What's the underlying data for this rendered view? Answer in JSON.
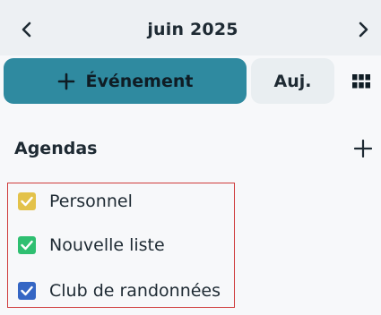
{
  "header": {
    "month_label": "juin 2025",
    "prev_icon": "chevron-left-icon",
    "next_icon": "chevron-right-icon"
  },
  "toolbar": {
    "new_event_label": "Événement",
    "new_event_icon": "plus-icon",
    "today_label": "Auj.",
    "view_icon": "grid-icon"
  },
  "calendars": {
    "title": "Agendas",
    "add_icon": "plus-icon",
    "items": [
      {
        "label": "Personnel",
        "color": "#e3c24a",
        "checked": true
      },
      {
        "label": "Nouvelle liste",
        "color": "#2fbf71",
        "checked": true
      },
      {
        "label": "Club de randonnées",
        "color": "#3566c4",
        "checked": true
      }
    ]
  },
  "colors": {
    "accent": "#2f8aa0",
    "header_bg": "#edf0f3",
    "selection_outline": "#cf3b3b"
  }
}
